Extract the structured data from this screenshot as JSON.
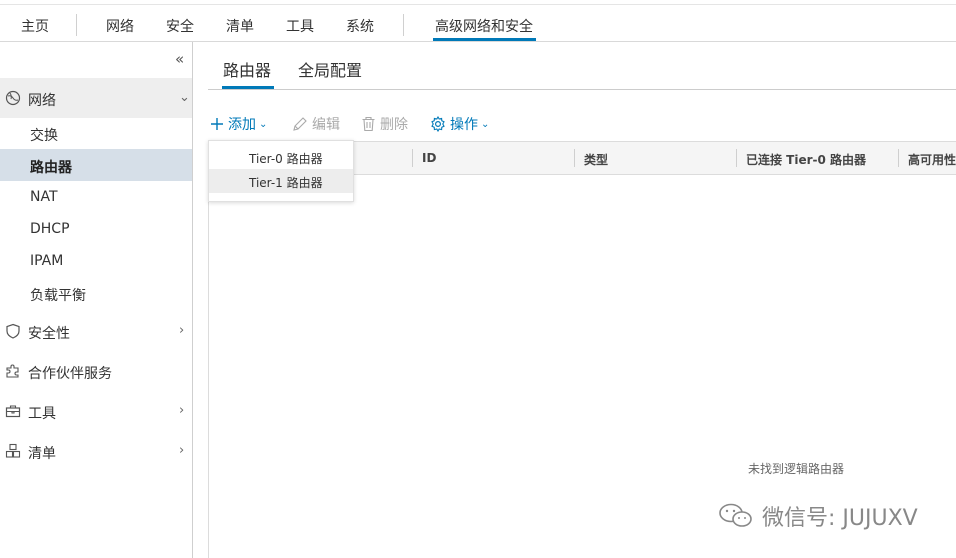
{
  "topnav": {
    "items": [
      "主页",
      "网络",
      "安全",
      "清单",
      "工具",
      "系统"
    ],
    "active": "高级网络和安全"
  },
  "sidebar": {
    "collapse_glyph": "«",
    "groups": [
      {
        "label": "网络",
        "icon": "network-icon",
        "expanded": true
      },
      {
        "label": "安全性",
        "icon": "shield-icon"
      },
      {
        "label": "合作伙伴服务",
        "icon": "puzzle-icon"
      },
      {
        "label": "工具",
        "icon": "toolbox-icon"
      },
      {
        "label": "清单",
        "icon": "inventory-icon"
      }
    ],
    "network_items": [
      "交换",
      "路由器",
      "NAT",
      "DHCP",
      "IPAM",
      "负载平衡"
    ],
    "active_item": "路由器"
  },
  "tabs": [
    "路由器",
    "全局配置"
  ],
  "toolbar": {
    "add": "添加",
    "edit": "编辑",
    "delete": "删除",
    "actions": "操作"
  },
  "add_menu": [
    "Tier-0 路由器",
    "Tier-1 路由器"
  ],
  "grid": {
    "columns": [
      "ID",
      "类型",
      "已连接 Tier-0 路由器",
      "高可用性"
    ],
    "empty_message": "未找到逻辑路由器"
  },
  "watermark": "微信号: JUJUXV",
  "colors": {
    "accent": "#0079b8",
    "active_row": "#d6dfe8"
  }
}
